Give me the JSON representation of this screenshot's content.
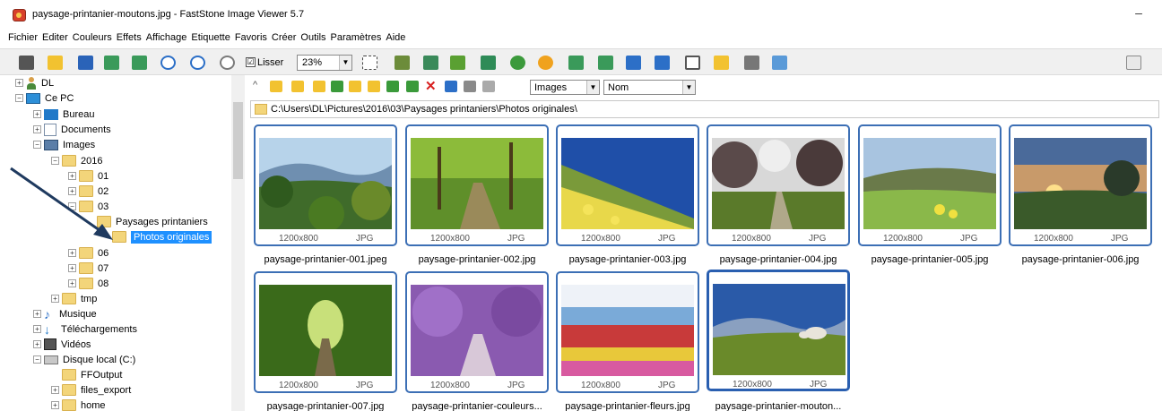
{
  "window": {
    "title": "paysage-printanier-moutons.jpg  -  FastStone Image Viewer 5.7",
    "minimize_symbol": "–"
  },
  "menu": [
    "Fichier",
    "Editer",
    "Couleurs",
    "Effets",
    "Affichage",
    "Etiquette",
    "Favoris",
    "Créer",
    "Outils",
    "Paramètres",
    "Aide"
  ],
  "toolbar": {
    "lisser_label": "Lisser",
    "lisser_checked": "☑",
    "zoom_value": "23%"
  },
  "tree": {
    "items": [
      {
        "label": "DL",
        "icon": "user-icon"
      },
      {
        "label": "Ce PC",
        "icon": "pc-icon"
      },
      {
        "label": "Bureau",
        "icon": "desktop-folder-icon"
      },
      {
        "label": "Documents",
        "icon": "documents-icon"
      },
      {
        "label": "Images",
        "icon": "images-icon"
      },
      {
        "label": "2016",
        "icon": "folder-icon"
      },
      {
        "label": "01",
        "icon": "folder-icon"
      },
      {
        "label": "02",
        "icon": "folder-icon"
      },
      {
        "label": "03",
        "icon": "folder-icon"
      },
      {
        "label": "Paysages printaniers",
        "icon": "folder-icon"
      },
      {
        "label": "Photos originales",
        "icon": "folder-icon"
      },
      {
        "label": "06",
        "icon": "folder-icon"
      },
      {
        "label": "07",
        "icon": "folder-icon"
      },
      {
        "label": "08",
        "icon": "folder-icon"
      },
      {
        "label": "tmp",
        "icon": "folder-icon"
      },
      {
        "label": "Musique",
        "icon": "music-icon"
      },
      {
        "label": "Téléchargements",
        "icon": "download-icon"
      },
      {
        "label": "Vidéos",
        "icon": "video-icon"
      },
      {
        "label": "Disque local (C:)",
        "icon": "disk-icon"
      },
      {
        "label": "FFOutput",
        "icon": "folder-icon"
      },
      {
        "label": "files_export",
        "icon": "folder-icon"
      },
      {
        "label": "home",
        "icon": "folder-icon"
      }
    ]
  },
  "nav": {
    "filter_value": "Images",
    "sort_value": "Nom"
  },
  "path": "C:\\Users\\DL\\Pictures\\2016\\03\\Paysages printaniers\\Photos originales\\",
  "thumbnails": [
    {
      "name": "paysage-printanier-001.jpeg",
      "dims": "1200x800",
      "format": "JPG"
    },
    {
      "name": "paysage-printanier-002.jpg",
      "dims": "1200x800",
      "format": "JPG"
    },
    {
      "name": "paysage-printanier-003.jpg",
      "dims": "1200x800",
      "format": "JPG"
    },
    {
      "name": "paysage-printanier-004.jpg",
      "dims": "1200x800",
      "format": "JPG"
    },
    {
      "name": "paysage-printanier-005.jpg",
      "dims": "1200x800",
      "format": "JPG"
    },
    {
      "name": "paysage-printanier-006.jpg",
      "dims": "1200x800",
      "format": "JPG"
    },
    {
      "name": "paysage-printanier-007.jpg",
      "dims": "1200x800",
      "format": "JPG"
    },
    {
      "name": "paysage-printanier-couleurs...",
      "dims": "1200x800",
      "format": "JPG"
    },
    {
      "name": "paysage-printanier-fleurs.jpg",
      "dims": "1200x800",
      "format": "JPG"
    },
    {
      "name": "paysage-printanier-mouton...",
      "dims": "1200x800",
      "format": "JPG"
    }
  ],
  "colors": {
    "selection": "#1e90ff",
    "thumb_border": "#3c6fb5",
    "annotation_arrow": "#1f3a5f"
  }
}
